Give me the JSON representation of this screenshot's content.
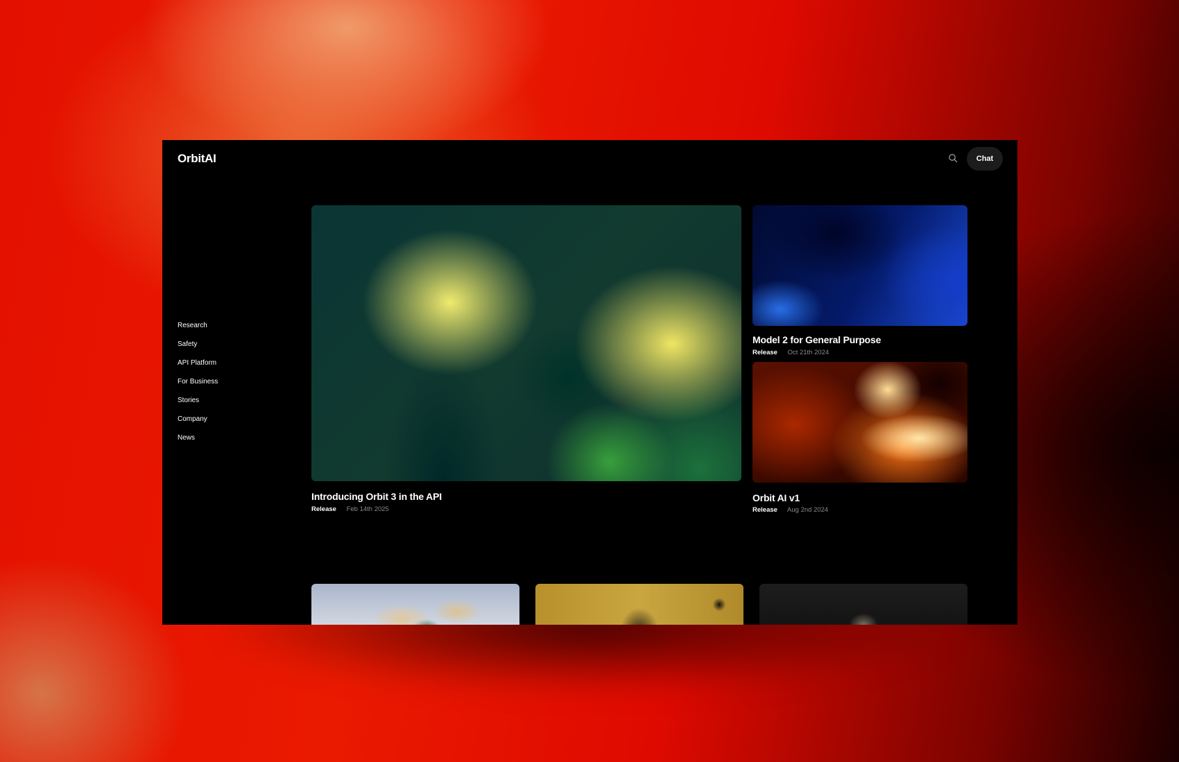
{
  "brand": {
    "logo": "OrbitAI"
  },
  "header": {
    "chat_label": "Chat",
    "search_icon": "search-icon"
  },
  "nav": {
    "items": [
      {
        "label": "Research"
      },
      {
        "label": "Safety"
      },
      {
        "label": "API Platform"
      },
      {
        "label": "For Business"
      },
      {
        "label": "Stories"
      },
      {
        "label": "Company"
      },
      {
        "label": "News"
      }
    ]
  },
  "featured": {
    "title": "Introducing Orbit 3 in the API",
    "tag": "Release",
    "date": "Feb 14th 2025"
  },
  "side_posts": [
    {
      "title": "Model 2 for General Purpose",
      "tag": "Release",
      "date": "Oct 21th 2024"
    },
    {
      "title": "Orbit AI v1",
      "tag": "Release",
      "date": "Aug 2nd 2024"
    }
  ],
  "colors": {
    "background": "#e31000",
    "window": "#000000",
    "chat_button": "#1c1c1c",
    "meta_date": "#8a8a8a"
  }
}
